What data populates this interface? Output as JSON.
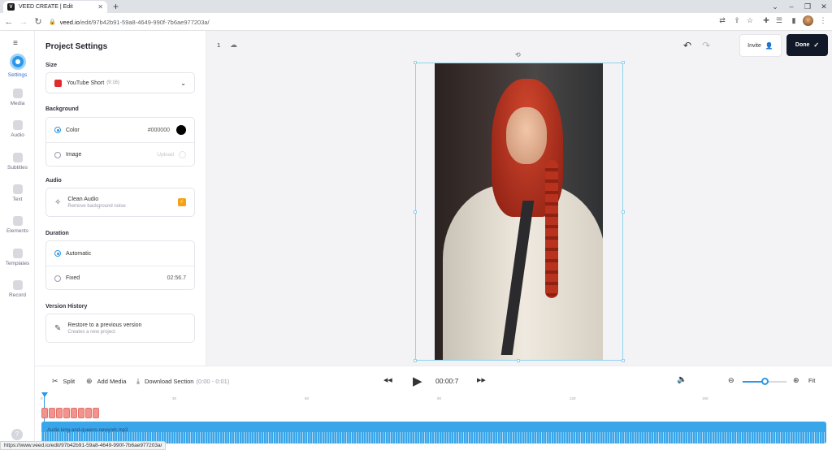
{
  "browser": {
    "tab_title": "VEED CREATE | Edit",
    "tab_favicon_letter": "V",
    "url_domain": "veed.io",
    "url_path": "/edit/97b42b91-59a8-4649-990f-7b6ae977203a/",
    "status_url": "https://www.veed.io/edit/97b42b91-59a8-4649-990f-7b6ae977203a/"
  },
  "rail": {
    "items": [
      {
        "label": "Settings",
        "icon": "settings-icon"
      },
      {
        "label": "Media",
        "icon": "media-icon"
      },
      {
        "label": "Audio",
        "icon": "audio-icon"
      },
      {
        "label": "Subtitles",
        "icon": "subtitles-icon"
      },
      {
        "label": "Text",
        "icon": "text-icon"
      },
      {
        "label": "Elements",
        "icon": "elements-icon"
      },
      {
        "label": "Templates",
        "icon": "templates-icon"
      },
      {
        "label": "Record",
        "icon": "record-icon"
      }
    ]
  },
  "panel": {
    "title": "Project Settings",
    "size_label": "Size",
    "size_value": "YouTube Short",
    "size_ratio": "(9:16)",
    "background_label": "Background",
    "color_label": "Color",
    "color_hex": "#000000",
    "image_label": "Image",
    "upload_label": "Upload",
    "audio_label": "Audio",
    "clean_audio": "Clean Audio",
    "clean_audio_sub": "Remove background noise",
    "duration_label": "Duration",
    "automatic_label": "Automatic",
    "fixed_label": "Fixed",
    "fixed_value": "02:56.7",
    "version_label": "Version History",
    "restore_title": "Restore to a previous version",
    "restore_sub": "Creates a new project"
  },
  "canvas": {
    "page_number": "1",
    "invite_label": "Invite",
    "done_label": "Done"
  },
  "controls": {
    "split": "Split",
    "add_media": "Add Media",
    "download_section": "Download Section",
    "download_range": "(0:00 - 0:01)",
    "time": "00:00:7",
    "fit": "Fit",
    "zoom_level": 0.5
  },
  "timeline": {
    "ticks": [
      "0",
      "30",
      "60",
      "90",
      "120",
      "150"
    ],
    "audio_track_label": "Audio king-and-queens-newyork.mp3"
  },
  "colors": {
    "accent": "#2b97e8",
    "done_bg": "#111827",
    "audio_track": "#3aa6ea",
    "clip": "#f2948e"
  }
}
